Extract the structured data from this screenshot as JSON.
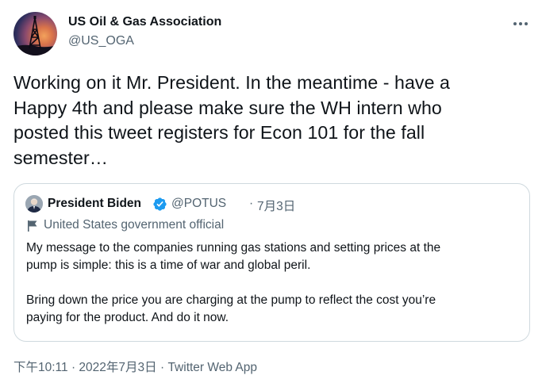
{
  "tweet": {
    "author": {
      "name": "US Oil & Gas Association",
      "handle": "@US_OGA"
    },
    "more_icon": "ellipsis-icon",
    "text_lines": [
      "Working on it Mr. President.  In the meantime - have a",
      "Happy 4th and please make sure the WH intern who",
      "posted this tweet registers for Econ 101 for the fall",
      "semester…"
    ],
    "quote": {
      "name": "President Biden",
      "verified_icon": "verified-badge-icon",
      "handle": "@POTUS",
      "separator": "·",
      "time": "7月3日",
      "label_icon": "flag-icon",
      "label": "United States government official",
      "paragraph1": [
        "My message to the companies running gas stations and setting prices at the",
        "pump is simple: this is a time of war and global peril."
      ],
      "paragraph2": [
        "Bring down the price you are charging at the pump to reflect the cost you’re",
        "paying for the product. And do it now."
      ]
    },
    "meta": {
      "time": "下午10:11",
      "separator": " · ",
      "date": "2022年7月3日",
      "source": "Twitter Web App"
    },
    "colors": {
      "text": "#0f1419",
      "secondary": "#536471",
      "border": "#cfd9de",
      "verified": "#1d9bf0"
    }
  }
}
